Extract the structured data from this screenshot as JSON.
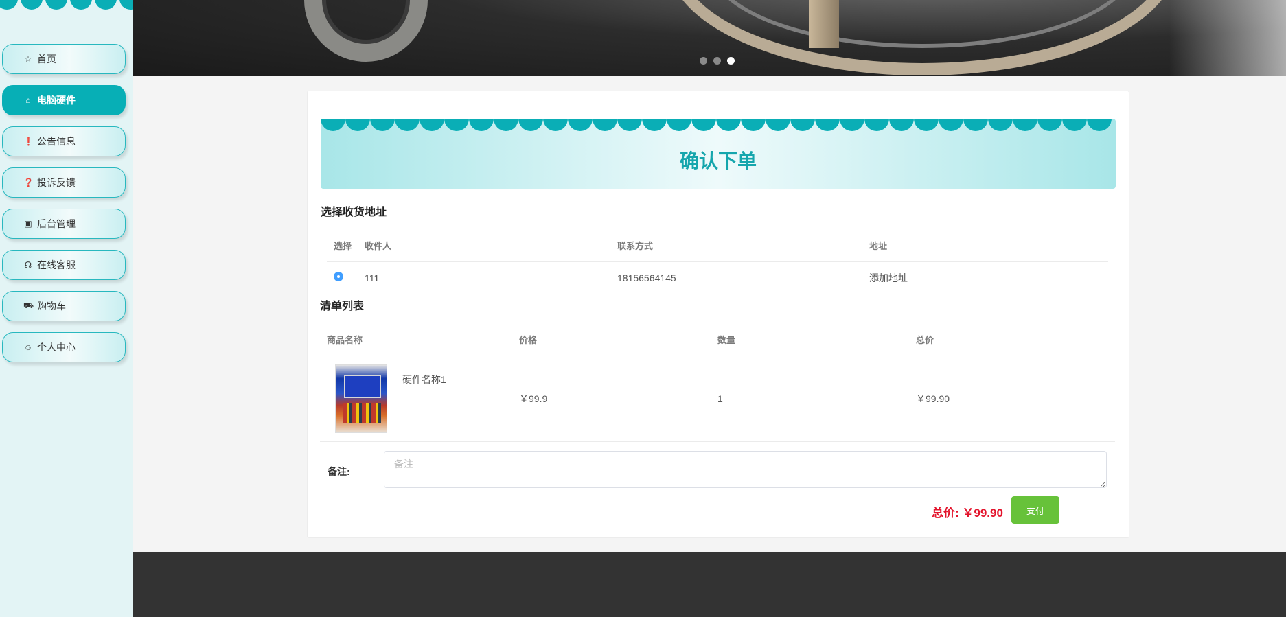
{
  "sidebar": {
    "items": [
      {
        "label": "首页",
        "icon": "star-icon",
        "glyph": "☆"
      },
      {
        "label": "电脑硬件",
        "icon": "shopping-bag-icon",
        "glyph": "⌂"
      },
      {
        "label": "公告信息",
        "icon": "info-circle-icon",
        "glyph": "❗"
      },
      {
        "label": "投诉反馈",
        "icon": "question-circle-icon",
        "glyph": "❓"
      },
      {
        "label": "后台管理",
        "icon": "briefcase-icon",
        "glyph": "▣"
      },
      {
        "label": "在线客服",
        "icon": "headset-icon",
        "glyph": "☊"
      },
      {
        "label": "购物车",
        "icon": "cart-icon",
        "glyph": "⛟"
      },
      {
        "label": "个人中心",
        "icon": "user-icon",
        "glyph": "☺"
      }
    ],
    "active_index": 1
  },
  "banner": {
    "dots": 3,
    "active_dot": 2
  },
  "checkout": {
    "title": "确认下单",
    "address_section": "选择收货地址",
    "address_headers": {
      "select": "选择",
      "receiver": "收件人",
      "contact": "联系方式",
      "address": "地址"
    },
    "address_rows": [
      {
        "receiver": "111",
        "contact": "18156564145",
        "address": "添加地址",
        "selected": true
      }
    ],
    "list_section": "清单列表",
    "goods_headers": {
      "name": "商品名称",
      "price": "价格",
      "qty": "数量",
      "total": "总价"
    },
    "goods_rows": [
      {
        "name": "硬件名称1",
        "price": "￥99.9",
        "qty": "1",
        "total": "￥99.90"
      }
    ],
    "note_label": "备注:",
    "note_placeholder": "备注",
    "total_label": "总价: ￥99.90",
    "pay_button": "支付"
  },
  "colors": {
    "accent": "#07afb6",
    "pay_green": "#67c23a",
    "total_red": "#e3142c",
    "footer": "#333333"
  }
}
